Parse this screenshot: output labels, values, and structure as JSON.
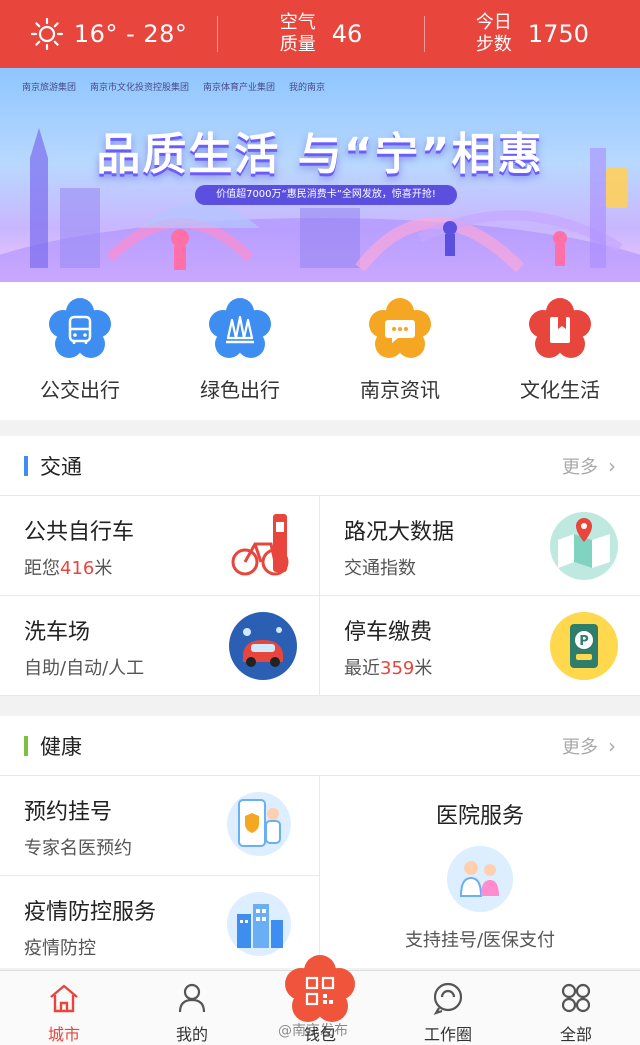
{
  "weather": {
    "icon": "sun-icon",
    "temp": "16° - 28°"
  },
  "air": {
    "label_line1": "空气",
    "label_line2": "质量",
    "value": "46"
  },
  "steps": {
    "label_line1": "今日",
    "label_line2": "步数",
    "value": "1750"
  },
  "banner": {
    "headline": "品质生活 与“宁”相惠",
    "sub": "价值超7000万“惠民消费卡”全网发放，惊喜开抢!",
    "logos": [
      "南京旅游集团",
      "南京市文化投资控股集团",
      "南京体育产业集团",
      "我的南京"
    ]
  },
  "quick": [
    {
      "label": "公交出行",
      "icon": "bus-icon",
      "color": "#3d8ef0"
    },
    {
      "label": "绿色出行",
      "icon": "trees-icon",
      "color": "#3d8ef0"
    },
    {
      "label": "南京资讯",
      "icon": "chat-icon",
      "color": "#f5a623"
    },
    {
      "label": "文化生活",
      "icon": "bookmark-icon",
      "color": "#e8453c"
    }
  ],
  "traffic": {
    "title": "交通",
    "bar_color": "#3d8ef0",
    "more": "更多",
    "cells": [
      {
        "title": "公共自行车",
        "sub_pre": "距您",
        "sub_hl": "416",
        "sub_post": "米",
        "icon": "bicycle-icon"
      },
      {
        "title": "路况大数据",
        "sub_pre": "交通指数",
        "sub_hl": "",
        "sub_post": "",
        "icon": "map-icon"
      },
      {
        "title": "洗车场",
        "sub_pre": "自助/自动/人工",
        "sub_hl": "",
        "sub_post": "",
        "icon": "car-wash-icon"
      },
      {
        "title": "停车缴费",
        "sub_pre": "最近",
        "sub_hl": "359",
        "sub_post": "米",
        "icon": "parking-icon"
      }
    ]
  },
  "health": {
    "title": "健康",
    "bar_color": "#7cc142",
    "more": "更多",
    "left": [
      {
        "title": "预约挂号",
        "sub": "专家名医预约",
        "icon": "phone-doctor-icon"
      },
      {
        "title": "疫情防控服务",
        "sub": "疫情防控",
        "icon": "city-buildings-icon"
      }
    ],
    "hospital": {
      "title": "医院服务",
      "sub": "支持挂号/医保支付",
      "icon": "doctors-icon"
    }
  },
  "tabbar": {
    "tabs": [
      {
        "label": "城市",
        "icon": "home-icon",
        "active": true
      },
      {
        "label": "我的",
        "icon": "user-icon",
        "active": false
      },
      {
        "label": "钱包",
        "icon": "qr-wallet-icon",
        "active": false
      },
      {
        "label": "工作圈",
        "icon": "circle-chat-icon",
        "active": false
      },
      {
        "label": "全部",
        "icon": "grid-icon",
        "active": false
      }
    ]
  },
  "watermark": "@南京发布"
}
